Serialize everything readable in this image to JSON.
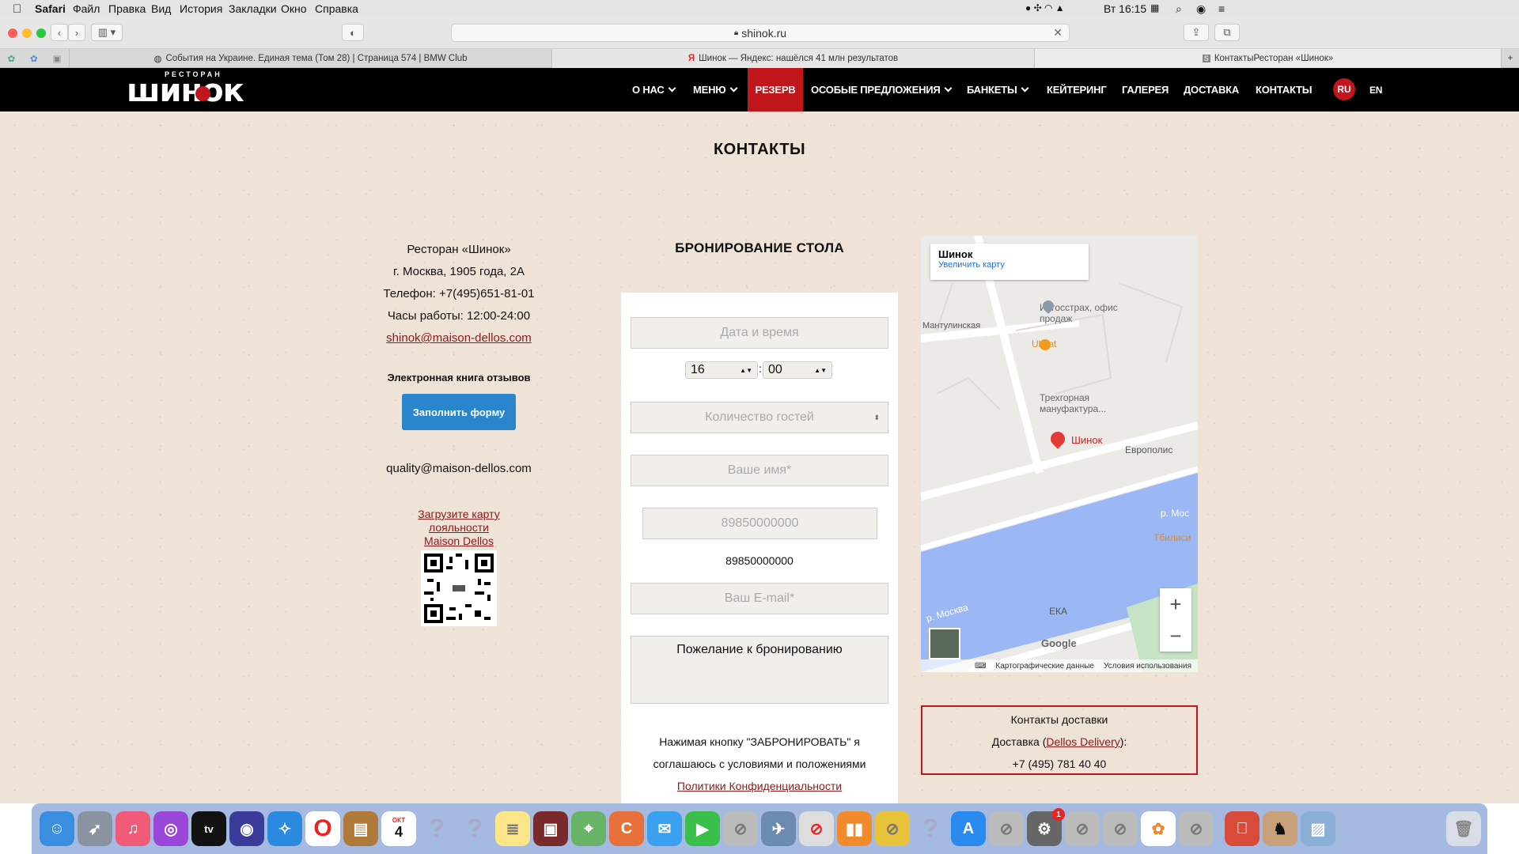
{
  "menubar": {
    "apple": "",
    "app": "Safari",
    "items": [
      "Файл",
      "Правка",
      "Вид",
      "История",
      "Закладки",
      "Окно",
      "Справка"
    ],
    "clock": "Вт 16:15"
  },
  "browser": {
    "url": "shinok.ru",
    "tabs": [
      "События на Украине. Единая тема (Том 28) | Страница 574 | BMW Club",
      "Шинок — Яндекс: нашёлся 41 млн результатов",
      "КонтактыРесторан «Шинок»"
    ]
  },
  "site": {
    "logo_small": "РЕСТОРАН",
    "logo": "шинок",
    "nav": [
      "О НАС",
      "МЕНЮ",
      "РЕЗЕРВ",
      "ОСОБЫЕ ПРЕДЛОЖЕНИЯ",
      "БАНКЕТЫ",
      "КЕЙТЕРИНГ",
      "ГАЛЕРЕЯ",
      "ДОСТАВКА",
      "КОНТАКТЫ"
    ],
    "lang": [
      "RU",
      "EN"
    ],
    "page_title": "КОНТАКТЫ",
    "info": {
      "name": "Ресторан «Шинок»",
      "address": "г. Москва, 1905 года, 2А",
      "phone": "Телефон: +7(495)651-81-01",
      "hours": "Часы работы: 12:00-24:00",
      "email": "shinok@maison-dellos.com",
      "review_label": "Электронная книга отзывов",
      "review_button": "Заполнить форму",
      "quality_email": "quality@maison-dellos.com",
      "loyalty_link": [
        "Загрузите карту",
        "лояльности",
        "Maison Dellos"
      ]
    },
    "booking": {
      "title": "БРОНИРОВАНИЕ СТОЛА",
      "date_placeholder": "Дата и время",
      "hour": "16",
      "minute": "00",
      "guests_placeholder": "Количество гостей",
      "name_placeholder": "Ваше имя*",
      "phone_placeholder": "89850000000",
      "phone_value": "89850000000",
      "email_placeholder": "Ваш E-mail*",
      "wish_placeholder": "Пожелание к бронированию",
      "agree": [
        "Нажимая кнопку \"ЗАБРОНИРОВАТЬ\" я",
        "соглашаюсь с условиями и положениями"
      ],
      "policy": "Политики Конфиденциальности"
    },
    "map": {
      "place": "Шинок",
      "enlarge": "Увеличить карту",
      "labels": [
        "Ингосстрах, офис продаж",
        "Uhvat",
        "Трехгорная мануфактура...",
        "Шинок",
        "Европолис",
        "р. Москва",
        "р. Мос",
        "Тбилиси",
        "ЕКА",
        "Мантулинская",
        "Google"
      ],
      "footer": [
        "Картографические данные",
        "Условия использования"
      ]
    },
    "delivery": {
      "title": "Контакты доставки",
      "line_prefix": "Доставка (",
      "link": "Dellos Delivery",
      "line_suffix": "):",
      "phone": "+7 (495) 781 40 40"
    }
  },
  "dock": {
    "calendar_month": "ОКТ",
    "calendar_day": "4",
    "badge": "1"
  },
  "colors": {
    "accent": "#c0161c",
    "link": "#8b1a1a",
    "button": "#2a86cc",
    "map_water": "#9bb8f5"
  }
}
